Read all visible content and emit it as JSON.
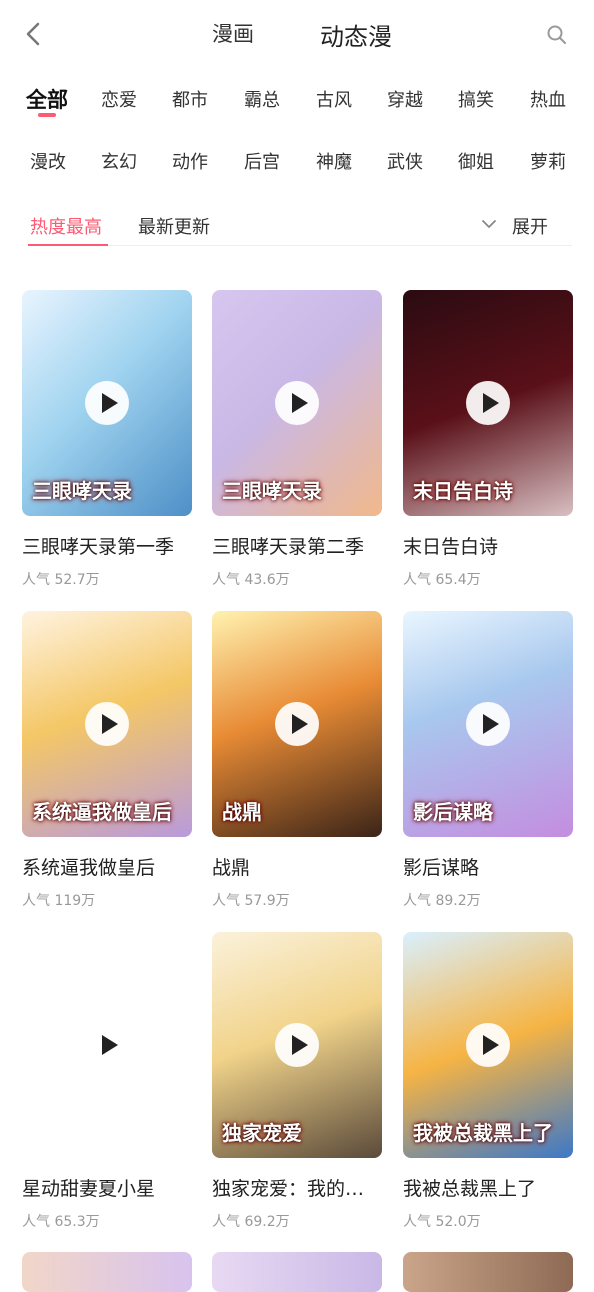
{
  "header": {
    "back_icon": "chevron-left-icon",
    "tabs": [
      "漫画",
      "动态漫"
    ],
    "search_icon": "search-icon"
  },
  "categories": {
    "row1": [
      "全部",
      "恋爱",
      "都市",
      "霸总",
      "古风",
      "穿越",
      "搞笑",
      "热血"
    ],
    "row2": [
      "漫改",
      "玄幻",
      "动作",
      "后宫",
      "神魔",
      "武侠",
      "御姐",
      "萝莉"
    ],
    "active": "全部"
  },
  "sort": {
    "options": [
      "热度最高",
      "最新更新"
    ],
    "active": "热度最高",
    "expand_label": "展开",
    "expand_icon": "chevron-down-icon"
  },
  "items": [
    {
      "title": "三眼哮天录第一季",
      "popularity": "人气 52.7万",
      "cover_text": "三眼哮天录"
    },
    {
      "title": "三眼哮天录第二季",
      "popularity": "人气 43.6万",
      "cover_text": "三眼哮天录"
    },
    {
      "title": "末日告白诗",
      "popularity": "人气 65.4万",
      "cover_text": "末日告白诗"
    },
    {
      "title": "系统逼我做皇后",
      "popularity": "人气 119万",
      "cover_text": "系统逼我做皇后"
    },
    {
      "title": "战鼎",
      "popularity": "人气 57.9万",
      "cover_text": "战鼎"
    },
    {
      "title": "影后谋略",
      "popularity": "人气 89.2万",
      "cover_text": "影后谋略"
    },
    {
      "title": "星动甜妻夏小星",
      "popularity": "人气 65.3万",
      "cover_text": ""
    },
    {
      "title": "独家宠爱：我的…",
      "popularity": "人气 69.2万",
      "cover_text": "独家宠爱"
    },
    {
      "title": "我被总裁黑上了",
      "popularity": "人气 52.0万",
      "cover_text": "我被总裁黑上了"
    }
  ],
  "colors": {
    "accent": "#ff5a73",
    "covers": [
      "#9fd3ef",
      "#c9b8e6",
      "#5a1018",
      "#f4c766",
      "#e88b35",
      "#c48de0",
      "#ffffff",
      "#f1d38a",
      "#f6b444"
    ]
  }
}
